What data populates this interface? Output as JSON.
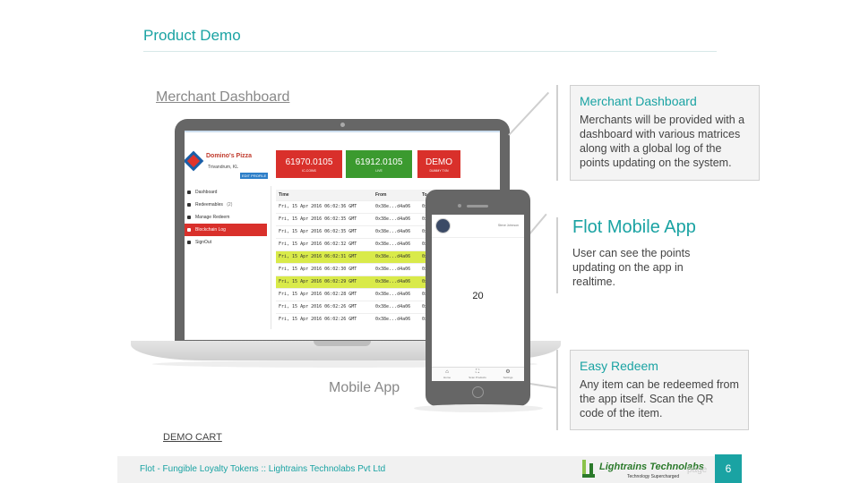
{
  "slide": {
    "title": "Product Demo",
    "merchant_label": "Merchant Dashboard",
    "mobile_label": "Mobile App",
    "demo_cart": "DEMO CART"
  },
  "dashboard": {
    "brand": "Domino's Pizza",
    "city": "Trivandrum, KL",
    "edit_profile": "EDIT PROFILE",
    "stats": [
      {
        "value": "61970.0105",
        "label": "IC-COINS",
        "color": "#d9302b"
      },
      {
        "value": "61912.0105",
        "label": "LIVE",
        "color": "#3b9a2f"
      },
      {
        "value": "DEMO",
        "label": "DUMMY TXN",
        "color": "#d9302b"
      }
    ],
    "menu": [
      {
        "label": "Dashboard",
        "icon": "user-icon"
      },
      {
        "label": "Redeemables",
        "badge": "(2)",
        "icon": "list-icon"
      },
      {
        "label": "Manage Redeem",
        "icon": "cart-icon"
      },
      {
        "label": "Blockchain Log",
        "icon": "log-icon",
        "active": true
      },
      {
        "label": "SignOut",
        "icon": "signout-icon"
      }
    ],
    "table": {
      "headers": [
        "Time",
        "From",
        "To"
      ],
      "rows": [
        [
          "Fri, 15 Apr 2016 06:02:36 GMT",
          "0x38e...d4a06",
          "0x"
        ],
        [
          "Fri, 15 Apr 2016 06:02:35 GMT",
          "0x38e...d4a06",
          "0x"
        ],
        [
          "Fri, 15 Apr 2016 06:02:35 GMT",
          "0x38e...d4a06",
          "0x"
        ],
        [
          "Fri, 15 Apr 2016 06:02:32 GMT",
          "0x38e...d4a06",
          "0x"
        ],
        [
          "Fri, 15 Apr 2016 06:02:31 GMT",
          "0x38e...d4a06",
          "0x"
        ],
        [
          "Fri, 15 Apr 2016 06:02:30 GMT",
          "0x38e...d4a06",
          "0x"
        ],
        [
          "Fri, 15 Apr 2016 06:02:29 GMT",
          "0x38e...d4a06",
          "0x"
        ],
        [
          "Fri, 15 Apr 2016 06:02:28 GMT",
          "0x38e...d4a06",
          "0x"
        ],
        [
          "Fri, 15 Apr 2016 06:02:26 GMT",
          "0x38e...d4a06",
          "0x"
        ],
        [
          "Fri, 15 Apr 2016 06:02:26 GMT",
          "0x38e...d4a06",
          "0x"
        ]
      ],
      "highlighted_rows": [
        4,
        6
      ],
      "highlight_color": "#d9ea4a"
    }
  },
  "phone": {
    "user_name": "Steve Johnson",
    "points": "20",
    "tabs": [
      {
        "label": "Home",
        "icon": "home-icon"
      },
      {
        "label": "Scan Products",
        "icon": "scan-icon"
      },
      {
        "label": "Settings",
        "icon": "gear-icon"
      }
    ]
  },
  "callouts": {
    "merchant": {
      "title": "Merchant Dashboard",
      "text": "Merchants will be provided with a dashboard with various matrices along with a global log of the points updating on the system."
    },
    "flot": {
      "title": "Flot Mobile App",
      "text": "User can see the points updating on the app in realtime."
    },
    "redeem": {
      "title": "Easy Redeem",
      "text": "Any item can be redeemed from the app itself. Scan the QR code of the item."
    }
  },
  "footer": {
    "text": "Flot - Fungible Loyalty Tokens :: Lightrains Technolabs Pvt Ltd",
    "logo_name": "Lightrains Technolabs",
    "logo_tagline": "Technology Supercharged",
    "page_label": "page",
    "page_number": "6"
  },
  "colors": {
    "accent": "#1aa3a3",
    "danger": "#d9302b",
    "success": "#3b9a2f"
  }
}
